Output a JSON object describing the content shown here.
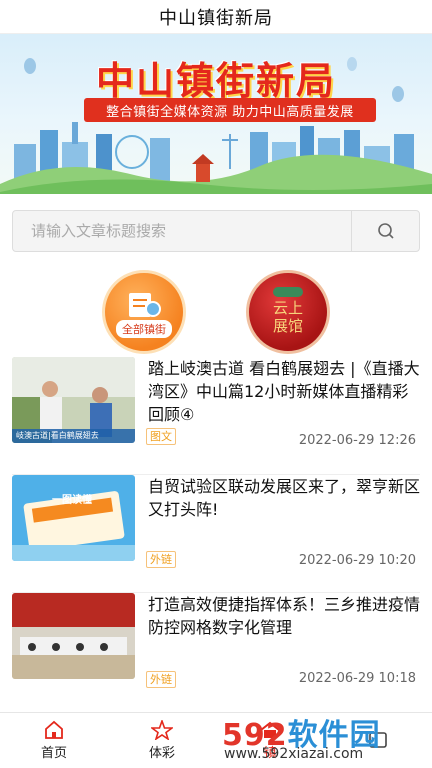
{
  "app": {
    "title": "中山镇街新局"
  },
  "banner": {
    "title": "中山镇街新局",
    "subtitle": "整合镇街全媒体资源  助力中山高质量发展"
  },
  "search": {
    "placeholder": "请输入文章标题搜索"
  },
  "quick_links": [
    {
      "label": "全部镇街",
      "icon": "document-magnifier-icon"
    },
    {
      "label_line1": "云上",
      "label_line2": "展馆",
      "icon": "cloud-exhibition-icon"
    }
  ],
  "news": [
    {
      "title": "踏上岐澳古道 看白鹤展翅去 |《直播大湾区》中山篇12小时新媒体直播精彩回顾④",
      "tag": "图文",
      "time": "2022-06-29 12:26",
      "thumb_caption": "岐澳古道|看白鹤展翅去"
    },
    {
      "title": "自贸试验区联动发展区来了，翠亨新区又打头阵!",
      "tag": "外链",
      "time": "2022-06-29 10:20",
      "thumb_caption": "一图读懂"
    },
    {
      "title": "打造高效便捷指挥体系！三乡推进疫情防控网格数字化管理",
      "tag": "外链",
      "time": "2022-06-29 10:18"
    }
  ],
  "tabs": [
    {
      "label": "首页",
      "icon": "home-icon"
    },
    {
      "label": "体彩",
      "icon": "lottery-icon"
    },
    {
      "label": "镇",
      "icon": "town-icon"
    },
    {
      "label": "",
      "icon": "profile-icon"
    }
  ],
  "watermark": {
    "brand_num": "592",
    "brand_text": "软件园",
    "url": "www.592xiazai.com"
  },
  "colors": {
    "brand_red": "#e4281c",
    "tag_orange": "#f0a020",
    "accent_blue": "#2b8fd6"
  }
}
